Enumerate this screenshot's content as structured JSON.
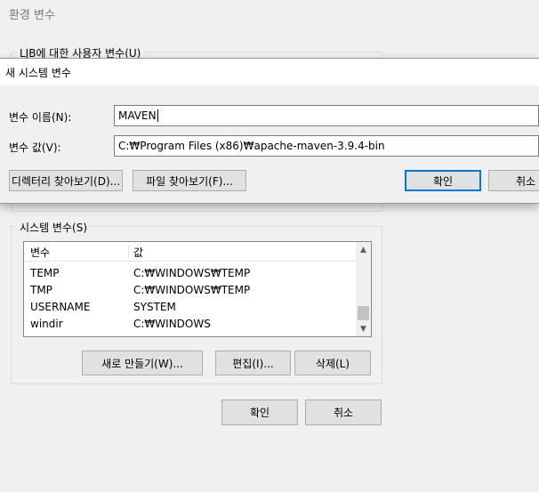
{
  "parent_dialog": {
    "title": "환경 변수",
    "user_group_label": "LJB에 대한 사용자 변수(U)",
    "system_group_label": "시스템 변수(S)",
    "columns": [
      "변수",
      "값"
    ],
    "system_rows": [
      {
        "name": "TEMP",
        "value": "C:₩WINDOWS₩TEMP"
      },
      {
        "name": "TMP",
        "value": "C:₩WINDOWS₩TEMP"
      },
      {
        "name": "USERNAME",
        "value": "SYSTEM"
      },
      {
        "name": "windir",
        "value": "C:₩WINDOWS"
      }
    ],
    "new_button": "새로 만들기(W)...",
    "edit_button": "편집(I)...",
    "delete_button": "삭제(L)",
    "ok_button": "확인",
    "cancel_button": "취소"
  },
  "new_var_dialog": {
    "title": "새 시스템 변수",
    "name_label": "변수 이름(N):",
    "name_value": "MAVEN",
    "value_label": "변수 값(V):",
    "value_value": "C:₩Program Files (x86)₩apache-maven-3.9.4-bin",
    "browse_dir_button": "디렉터리 찾아보기(D)...",
    "browse_file_button": "파일 찾아보기(F)...",
    "ok_button": "확인",
    "cancel_button": "취소"
  },
  "colors": {
    "accent": "#0078d7",
    "dialog_bg": "#f0f0f0"
  }
}
